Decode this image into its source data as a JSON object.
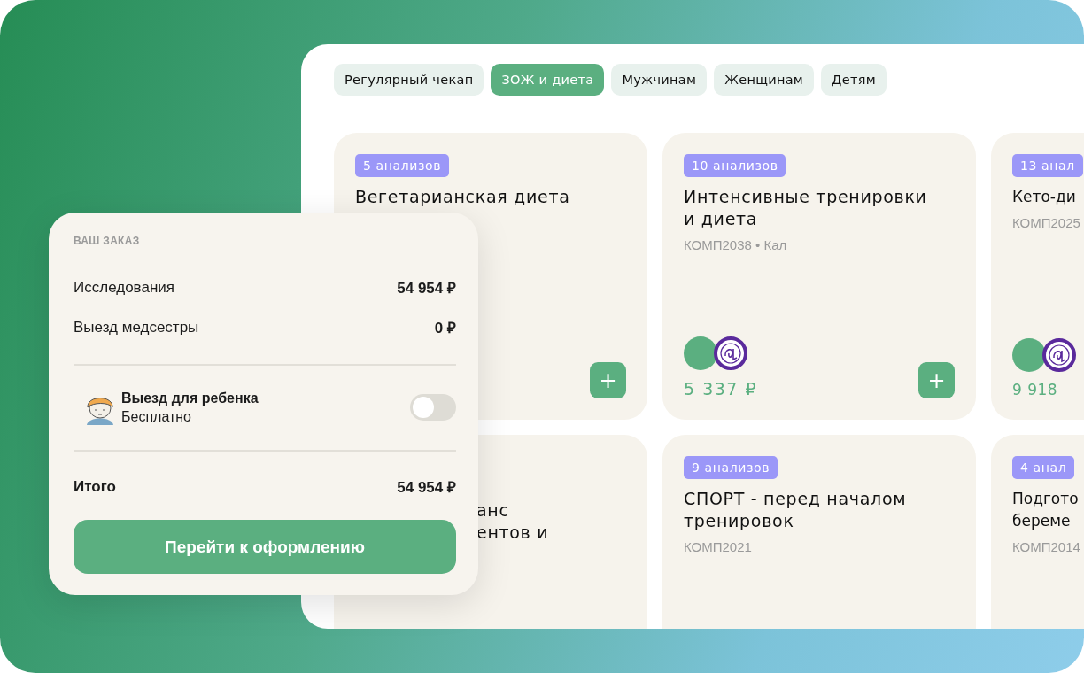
{
  "tabs": [
    {
      "label": "Регулярный чекап",
      "selected": false
    },
    {
      "label": "ЗОЖ и диета",
      "selected": true
    },
    {
      "label": "Мужчинам",
      "selected": false
    },
    {
      "label": "Женщинам",
      "selected": false
    },
    {
      "label": "Детям",
      "selected": false
    }
  ],
  "cards": [
    {
      "kind": "full",
      "tag": "5 анализов",
      "title": "Вегетарианская диета",
      "add": "+"
    },
    {
      "kind": "full",
      "tag": "10 анализов",
      "title": "Интенсивные тренировки\nи диета",
      "code": "КОМП2038 • Кал",
      "logos": true,
      "price": "5 337 ₽",
      "add": "+"
    },
    {
      "kind": "cut",
      "tag": "13 анал",
      "title": "Кето-ди",
      "code": "КОМП2025",
      "logos": true,
      "price": "9 918"
    },
    {
      "kind": "covered",
      "title": "анс\nентов и"
    },
    {
      "kind": "full",
      "tag": "9 анализов",
      "title": "СПОРТ - перед началом\nтренировок",
      "code": "КОМП2021"
    },
    {
      "kind": "cut",
      "tag": "4 анал",
      "title": "Подгото\nбереме",
      "code": "КОМП2014"
    }
  ],
  "order": {
    "heading": "ВАШ ЗАКАЗ",
    "lines": [
      {
        "label": "Исследования",
        "value": "54 954 ₽"
      },
      {
        "label": "Выезд медсестры",
        "value": "0 ₽"
      }
    ],
    "child_trip": {
      "title": "Выезд для ребенка",
      "subtitle": "Бесплатно",
      "on": false
    },
    "total": {
      "label": "Итого",
      "value": "54 954 ₽"
    },
    "button": "Перейти к оформлению"
  }
}
